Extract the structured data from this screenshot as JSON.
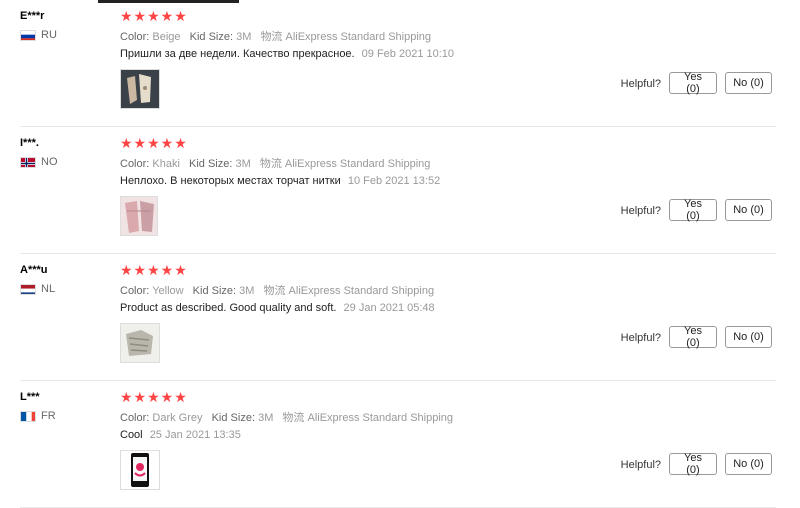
{
  "reviews": [
    {
      "user": "E***r",
      "country": "RU",
      "rating_stars": 5,
      "color_label": "Color:",
      "color": "Beige",
      "size_label": "Kid Size:",
      "size": "3M",
      "shipping": "物流 AliExpress Standard Shipping",
      "text": "Пришли за две недели. Качество прекрасное.",
      "date": "09 Feb 2021 10:10",
      "helpful_label": "Helpful?",
      "yes_label": "Yes (0)",
      "no_label": "No (0)"
    },
    {
      "user": "I***.",
      "country": "NO",
      "rating_stars": 5,
      "color_label": "Color:",
      "color": "Khaki",
      "size_label": "Kid Size:",
      "size": "3M",
      "shipping": "物流 AliExpress Standard Shipping",
      "text": "Неплохо. В некоторых местах торчат нитки",
      "date": "10 Feb 2021 13:52",
      "helpful_label": "Helpful?",
      "yes_label": "Yes (0)",
      "no_label": "No (0)"
    },
    {
      "user": "A***u",
      "country": "NL",
      "rating_stars": 5,
      "color_label": "Color:",
      "color": "Yellow",
      "size_label": "Kid Size:",
      "size": "3M",
      "shipping": "物流 AliExpress Standard Shipping",
      "text": "Product as described. Good quality and soft.",
      "date": "29 Jan 2021 05:48",
      "helpful_label": "Helpful?",
      "yes_label": "Yes (0)",
      "no_label": "No (0)"
    },
    {
      "user": "L***",
      "country": "FR",
      "rating_stars": 5,
      "color_label": "Color:",
      "color": "Dark Grey",
      "size_label": "Kid Size:",
      "size": "3M",
      "shipping": "物流 AliExpress Standard Shipping",
      "text": "Cool",
      "date": "25 Jan 2021 13:35",
      "helpful_label": "Helpful?",
      "yes_label": "Yes (0)",
      "no_label": "No (0)"
    }
  ],
  "star_glyph": "★★★★★",
  "accent_color": "#ff4747"
}
